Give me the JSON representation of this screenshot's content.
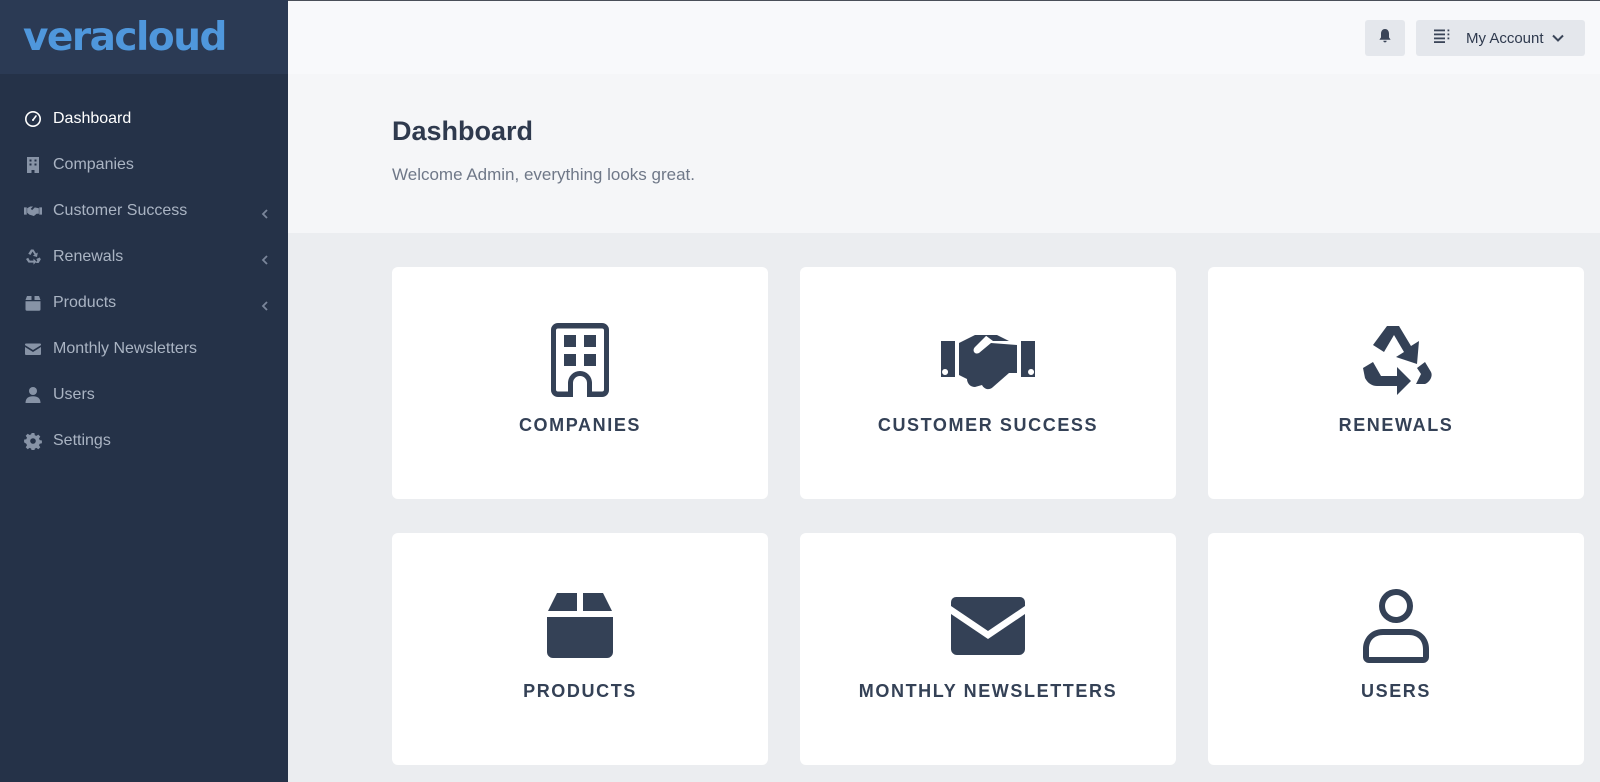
{
  "brand": {
    "logo_text": "veracloud",
    "logo_color": "#4f97dc"
  },
  "sidebar": {
    "items": [
      {
        "label": "Dashboard",
        "icon": "dashboard-gauge-icon",
        "active": true
      },
      {
        "label": "Companies",
        "icon": "building-icon"
      },
      {
        "label": "Customer Success",
        "icon": "handshake-icon",
        "expandable": true
      },
      {
        "label": "Renewals",
        "icon": "recycle-icon",
        "expandable": true
      },
      {
        "label": "Products",
        "icon": "box-icon",
        "expandable": true
      },
      {
        "label": "Monthly Newsletters",
        "icon": "envelope-icon"
      },
      {
        "label": "Users",
        "icon": "user-icon"
      },
      {
        "label": "Settings",
        "icon": "gear-icon"
      }
    ]
  },
  "header": {
    "notifications_icon": "bell-icon",
    "account_menu_icon": "list-icon",
    "account_label": "My Account"
  },
  "hero": {
    "title": "Dashboard",
    "subtitle": "Welcome Admin, everything looks great."
  },
  "cards": [
    {
      "label": "COMPANIES",
      "icon": "building-icon"
    },
    {
      "label": "CUSTOMER SUCCESS",
      "icon": "handshake-icon"
    },
    {
      "label": "RENEWALS",
      "icon": "recycle-icon"
    },
    {
      "label": "PRODUCTS",
      "icon": "box-icon"
    },
    {
      "label": "MONTHLY NEWSLETTERS",
      "icon": "envelope-icon"
    },
    {
      "label": "USERS",
      "icon": "user-icon"
    }
  ],
  "colors": {
    "sidebar_bg": "#253248",
    "brand_bg": "#2b3a54",
    "page_bg": "#ebedf0",
    "card_text": "#344156"
  }
}
